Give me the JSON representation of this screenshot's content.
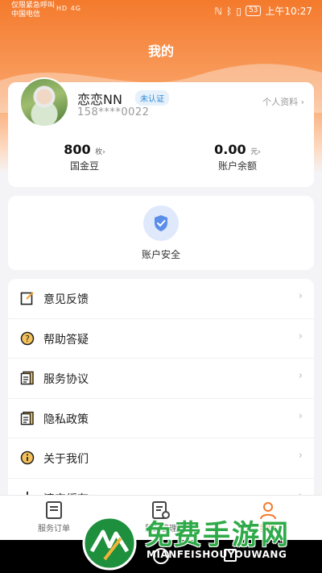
{
  "status_bar": {
    "carrier_line1": "仅限紧急呼叫",
    "carrier_line2": "中国电信",
    "signal_text": "HD 4G",
    "battery": "53",
    "time": "上午10:27"
  },
  "page_title": "我的",
  "profile": {
    "name": "恋恋NN",
    "verify_badge": "未认证",
    "phone": "158****0022",
    "profile_link": "个人资料",
    "stats": [
      {
        "value": "800",
        "unit": "枚",
        "label": "国金豆"
      },
      {
        "value": "0.00",
        "unit": "元",
        "label": "账户余额"
      }
    ]
  },
  "security": {
    "label": "账户安全",
    "icon": "shield-check-icon"
  },
  "menu": [
    {
      "label": "意见反馈",
      "icon": "edit-icon"
    },
    {
      "label": "帮助答疑",
      "icon": "question-icon"
    },
    {
      "label": "服务协议",
      "icon": "document-icon"
    },
    {
      "label": "隐私政策",
      "icon": "document-icon"
    },
    {
      "label": "关于我们",
      "icon": "info-icon"
    },
    {
      "label": "清空缓存",
      "icon": "broom-icon"
    }
  ],
  "tabs": [
    {
      "label": "服务订单",
      "icon": "order-icon"
    },
    {
      "label": "服务管理",
      "icon": "service-settings-icon"
    },
    {
      "label": "我的",
      "icon": "user-icon",
      "active": true
    }
  ],
  "watermark": {
    "title": "免费手游网",
    "subtitle": "MIANFEISHOUYOUWANG"
  },
  "colors": {
    "accent": "#f47a2c",
    "badge_blue": "#2e8bd6",
    "shield_blue": "#5a8ee8"
  }
}
